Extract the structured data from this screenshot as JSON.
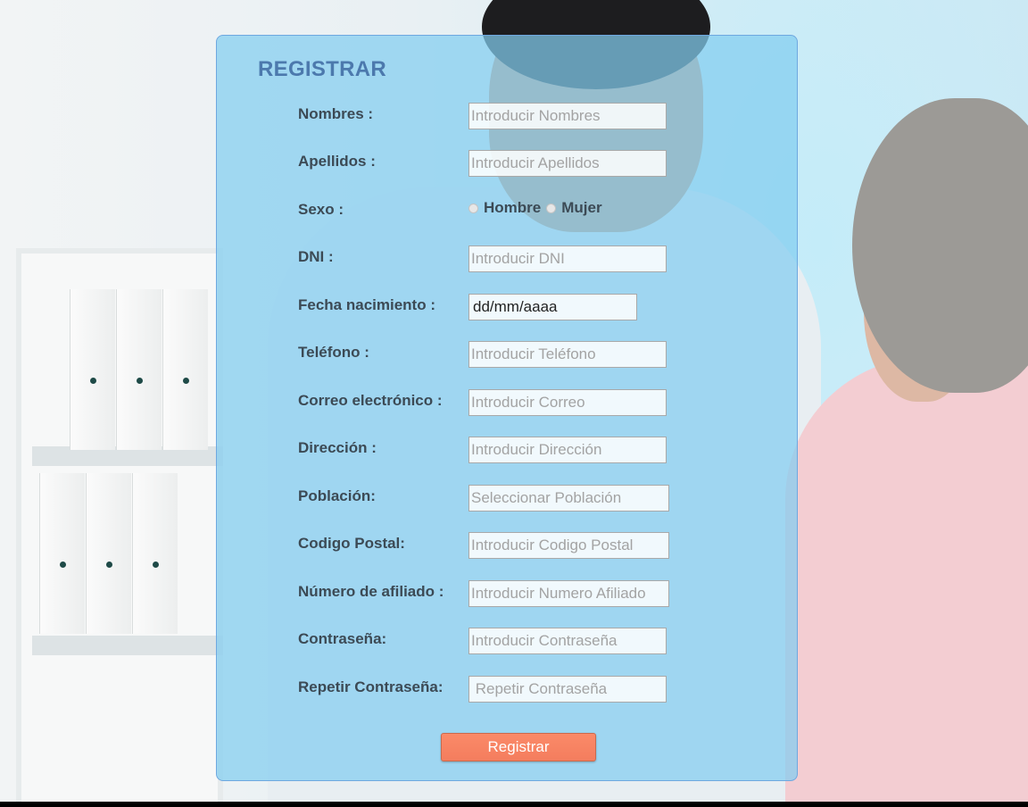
{
  "form": {
    "title": "REGISTRAR",
    "fields": {
      "nombres": {
        "label": "Nombres :",
        "placeholder": "Introducir Nombres"
      },
      "apellidos": {
        "label": "Apellidos :",
        "placeholder": "Introducir Apellidos"
      },
      "sexo": {
        "label": "Sexo :",
        "options": [
          "Hombre",
          "Mujer"
        ]
      },
      "dni": {
        "label": "DNI :",
        "placeholder": "Introducir DNI"
      },
      "fecha": {
        "label": "Fecha nacimiento :",
        "placeholder": "dd/mm/aaaa"
      },
      "telefono": {
        "label": "Teléfono :",
        "placeholder": "Introducir Teléfono"
      },
      "correo": {
        "label": "Correo electrónico :",
        "placeholder": "Introducir Correo"
      },
      "direccion": {
        "label": "Dirección :",
        "placeholder": "Introducir Dirección"
      },
      "poblacion": {
        "label": "Población:",
        "placeholder": "Seleccionar Población"
      },
      "codigo_postal": {
        "label": "Codigo Postal:",
        "placeholder": "Introducir Codigo Postal"
      },
      "afiliado": {
        "label": "Número de afiliado :",
        "placeholder": "Introducir Numero Afiliado"
      },
      "contrasena": {
        "label": "Contraseña:",
        "placeholder": "Introducir Contraseña"
      },
      "repetir": {
        "label": "Repetir Contraseña:",
        "placeholder": " Repetir Contraseña"
      }
    },
    "submit_label": "Registrar"
  },
  "colors": {
    "panel": "#82cdf0",
    "title": "#4c79ad",
    "button": "#f47d5e"
  }
}
